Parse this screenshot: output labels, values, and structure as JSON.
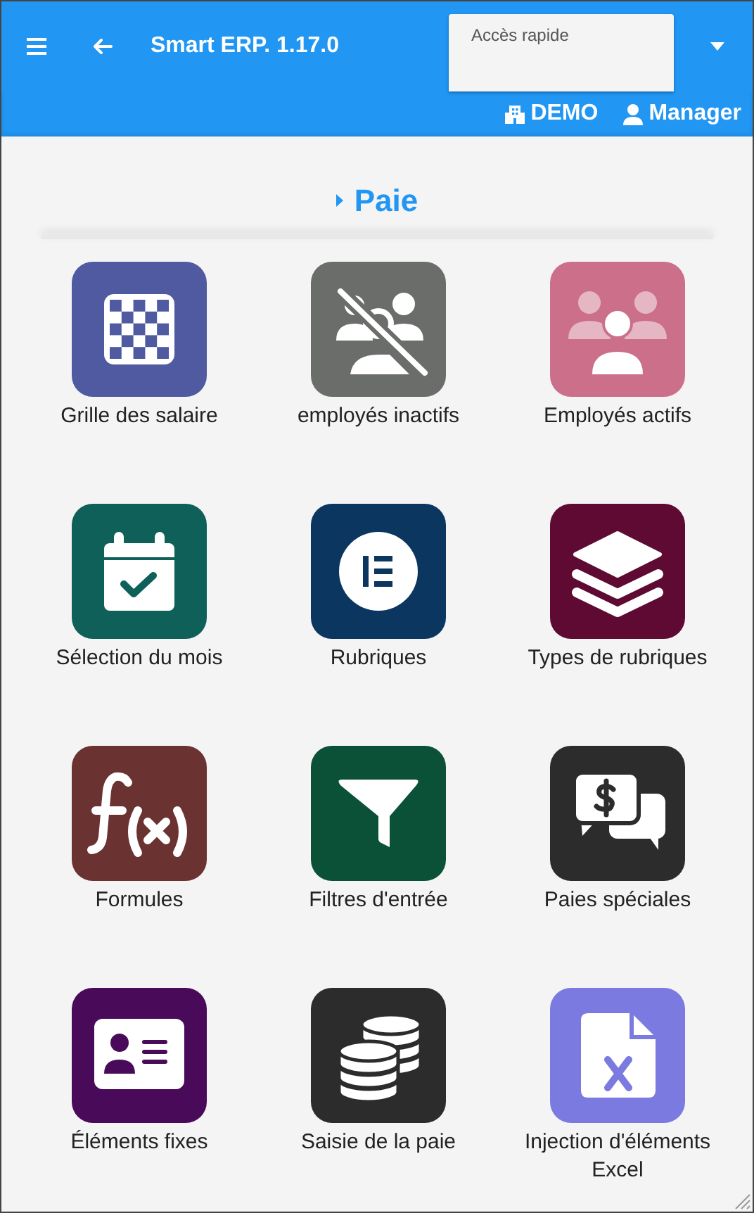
{
  "app_bar": {
    "title": "Smart ERP. 1.17.0",
    "quick_access": {
      "placeholder": "Accès rapide"
    }
  },
  "user_bar": {
    "company": "DEMO",
    "user": "Manager"
  },
  "section": {
    "title": "Paie"
  },
  "tiles": [
    {
      "label": "Grille des salaire",
      "color": "#4f5aa0",
      "kind": "grid"
    },
    {
      "label": "employés inactifs",
      "color": "#6b6d6a",
      "kind": "users-slash"
    },
    {
      "label": "Employés actifs",
      "color": "#cc6f8a",
      "kind": "users"
    },
    {
      "label": "Sélection du mois",
      "color": "#0e6058",
      "kind": "calendar"
    },
    {
      "label": "Rubriques",
      "color": "#0b365f",
      "kind": "elementor"
    },
    {
      "label": "Types de rubriques",
      "color": "#5e0a33",
      "kind": "layers"
    },
    {
      "label": "Formules",
      "color": "#6b3232",
      "kind": "function"
    },
    {
      "label": "Filtres d'entrée",
      "color": "#0b5137",
      "kind": "filter"
    },
    {
      "label": "Paies spéciales",
      "color": "#2c2c2c",
      "kind": "comments-dollar"
    },
    {
      "label": "Éléments fixes",
      "color": "#4a0a5a",
      "kind": "id-card"
    },
    {
      "label": "Saisie de la paie",
      "color": "#2c2c2c",
      "kind": "coins"
    },
    {
      "label": "Injection d'éléments Excel",
      "color": "#7a7ae0",
      "kind": "file-excel"
    }
  ]
}
